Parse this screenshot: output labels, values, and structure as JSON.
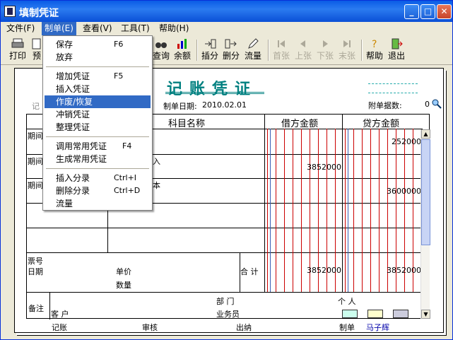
{
  "window": {
    "title": "填制凭证"
  },
  "menubar": [
    {
      "label": "文件(F)"
    },
    {
      "label": "制单(E)"
    },
    {
      "label": "查看(V)"
    },
    {
      "label": "工具(T)"
    },
    {
      "label": "帮助(H)"
    }
  ],
  "toolbar": {
    "print": "打印",
    "preview": "预",
    "query": "查询",
    "balance": "余额",
    "insert_split": "插分",
    "delete_split": "删分",
    "flow": "流量",
    "first": "首张",
    "prev": "上张",
    "next": "下张",
    "last": "末张",
    "help": "帮助",
    "exit": "退出"
  },
  "dropdown": {
    "items": [
      {
        "label": "保存",
        "shortcut": "F6"
      },
      {
        "label": "放弃",
        "shortcut": ""
      },
      {
        "label": "增加凭证",
        "shortcut": "F5"
      },
      {
        "label": "插入凭证",
        "shortcut": ""
      },
      {
        "label": "作废/恢复",
        "shortcut": ""
      },
      {
        "label": "冲销凭证",
        "shortcut": ""
      },
      {
        "label": "整理凭证",
        "shortcut": ""
      },
      {
        "label": "调用常用凭证",
        "shortcut": "F4"
      },
      {
        "label": "生成常用凭证",
        "shortcut": ""
      },
      {
        "label": "插入分录",
        "shortcut": "Ctrl+I"
      },
      {
        "label": "删除分录",
        "shortcut": "Ctrl+D"
      },
      {
        "label": "流量",
        "shortcut": ""
      }
    ]
  },
  "voucher": {
    "title": "记账凭证",
    "type_partial": "记",
    "date_label": "制单日期:",
    "date_value": "2010.02.01",
    "attach_label": "附单据数:",
    "attach_value": "0",
    "headers": {
      "subject": "科目名称",
      "debit": "借方金额",
      "credit": "贷方金额"
    },
    "rows": [
      {
        "summary": "期间",
        "subject": "",
        "debit": "",
        "credit": "252000"
      },
      {
        "summary": "期间",
        "subject": "入",
        "debit": "3852000",
        "credit": ""
      },
      {
        "summary": "期间",
        "subject": "本",
        "debit": "",
        "credit": "3600000"
      }
    ],
    "footer": {
      "ticket_no": "票号",
      "date": "日期",
      "unit_price": "单价",
      "quantity": "数量",
      "total_label": "合 计",
      "total_debit": "3852000",
      "total_credit": "3852000",
      "remark": "备注",
      "customer": "客 户",
      "department": "部 门",
      "person": "个 人",
      "salesperson": "业务员"
    },
    "signatures": {
      "bookkeeper": "记账",
      "auditor": "审核",
      "cashier": "出纳",
      "maker_label": "制单",
      "maker_name": "马子辉"
    }
  }
}
